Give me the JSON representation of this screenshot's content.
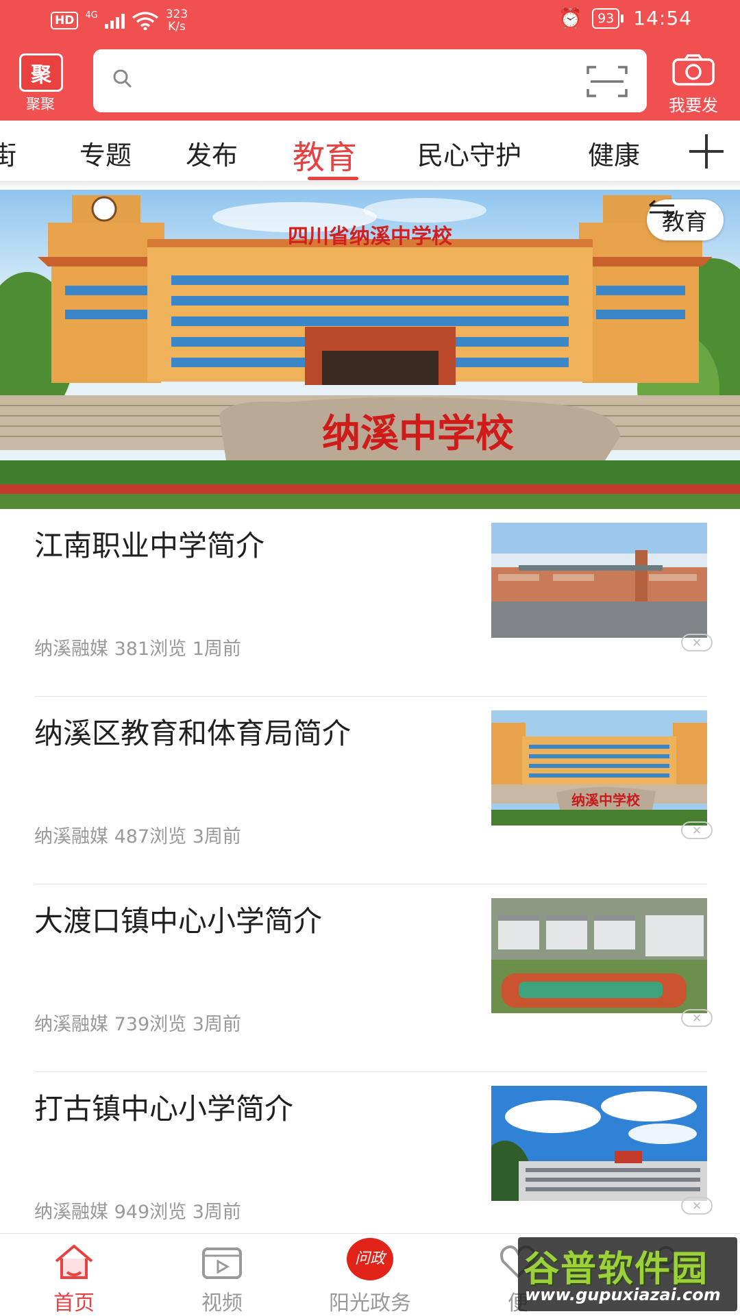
{
  "status_bar": {
    "hd": "HD",
    "network": "4G",
    "speed_value": "323",
    "speed_unit": "K/s",
    "battery": "93",
    "time": "14:54"
  },
  "header": {
    "logo_label": "聚聚",
    "search": {
      "placeholder": ""
    },
    "post_label": "我要发"
  },
  "tabs": [
    "街",
    "专题",
    "发布",
    "教育",
    "民心守护",
    "健康"
  ],
  "active_tab": "教育",
  "banner": {
    "tag_label": "教育",
    "sign_text": "四川省纳溪中学校",
    "stone_text": "纳溪中学校"
  },
  "news": [
    {
      "title": "江南职业中学简介",
      "source": "纳溪融媒",
      "views": "381浏览",
      "time": "1周前"
    },
    {
      "title": "纳溪区教育和体育局简介",
      "source": "纳溪融媒",
      "views": "487浏览",
      "time": "3周前"
    },
    {
      "title": "大渡口镇中心小学简介",
      "source": "纳溪融媒",
      "views": "739浏览",
      "time": "3周前"
    },
    {
      "title": "打古镇中心小学简介",
      "source": "纳溪融媒",
      "views": "949浏览",
      "time": "3周前"
    }
  ],
  "bottom_nav": {
    "home": "首页",
    "video": "视频",
    "gov_badge": "问政",
    "gov": "阳光政务",
    "service": "便"
  },
  "watermark": {
    "name": "谷普软件园",
    "url": "www.gupuxiazai.com"
  },
  "colors": {
    "brand_red": "#f0504f",
    "accent_red": "#e94040"
  }
}
